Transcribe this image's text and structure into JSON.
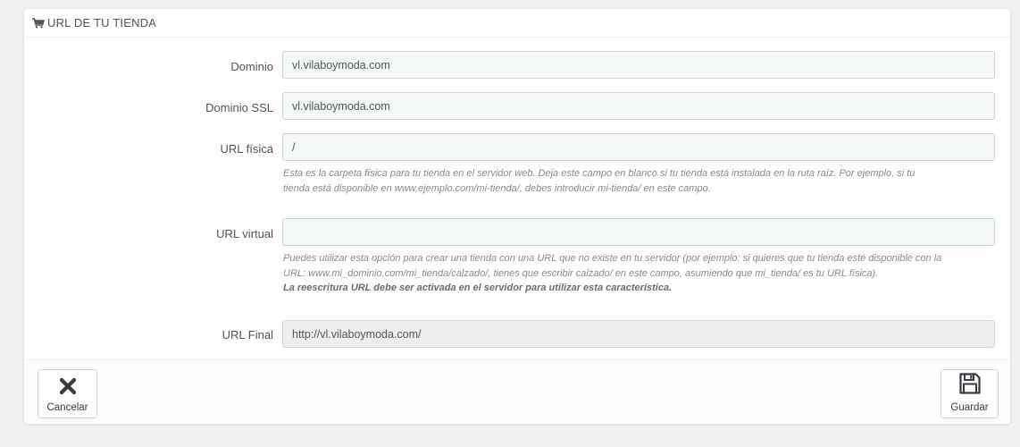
{
  "panel": {
    "title": "URL DE TU TIENDA",
    "icon": "cart-icon"
  },
  "fields": {
    "domain": {
      "label": "Dominio",
      "value": "vl.vilaboymoda.com"
    },
    "domain_ssl": {
      "label": "Dominio SSL",
      "value": "vl.vilaboymoda.com"
    },
    "physical_url": {
      "label": "URL física",
      "value": "/",
      "help_line1": "Esta es la carpeta física para tu tienda en el servidor web. Deja este campo en blanco si tu tienda está instalada en la ruta raíz. Por ejemplo, si tu",
      "help_line2": "tienda está disponible en www.ejemplo.com/mi-tienda/, debes introducir mi-tienda/ en este campo."
    },
    "virtual_url": {
      "label": "URL virtual",
      "value": "",
      "help_line1": "Puedes utilizar esta opción para crear una tienda con una URL que no existe en tu servidor (por ejemplo: si quieres que tu tienda esté disponible con la",
      "help_line2": "URL: www.mi_dominio.com/mi_tienda/calzado/, tienes que escribir calzado/ en este campo, asumiendo que mi_tienda/ es tu URL física).",
      "help_bold": "La reescritura URL debe ser activada en el servidor para utilizar esta característica."
    },
    "final_url": {
      "label": "URL Final",
      "value": "http://vl.vilaboymoda.com/"
    }
  },
  "footer": {
    "cancel_label": "Cancelar",
    "cancel_icon": "close-icon",
    "save_label": "Guardar",
    "save_icon": "floppy-disk-icon"
  }
}
